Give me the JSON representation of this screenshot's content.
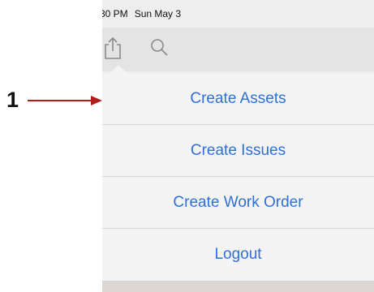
{
  "status_bar": {
    "time": "30 PM",
    "date": "Sun May 3"
  },
  "toolbar": {
    "share_icon": "share-icon",
    "search_icon": "search-icon"
  },
  "menu": {
    "items": [
      {
        "label": "Create Assets"
      },
      {
        "label": "Create Issues"
      },
      {
        "label": "Create Work Order"
      },
      {
        "label": "Logout"
      }
    ]
  },
  "annotation": {
    "number": "1",
    "color": "#b31b1b"
  },
  "colors": {
    "accent": "#2f6fd8"
  }
}
